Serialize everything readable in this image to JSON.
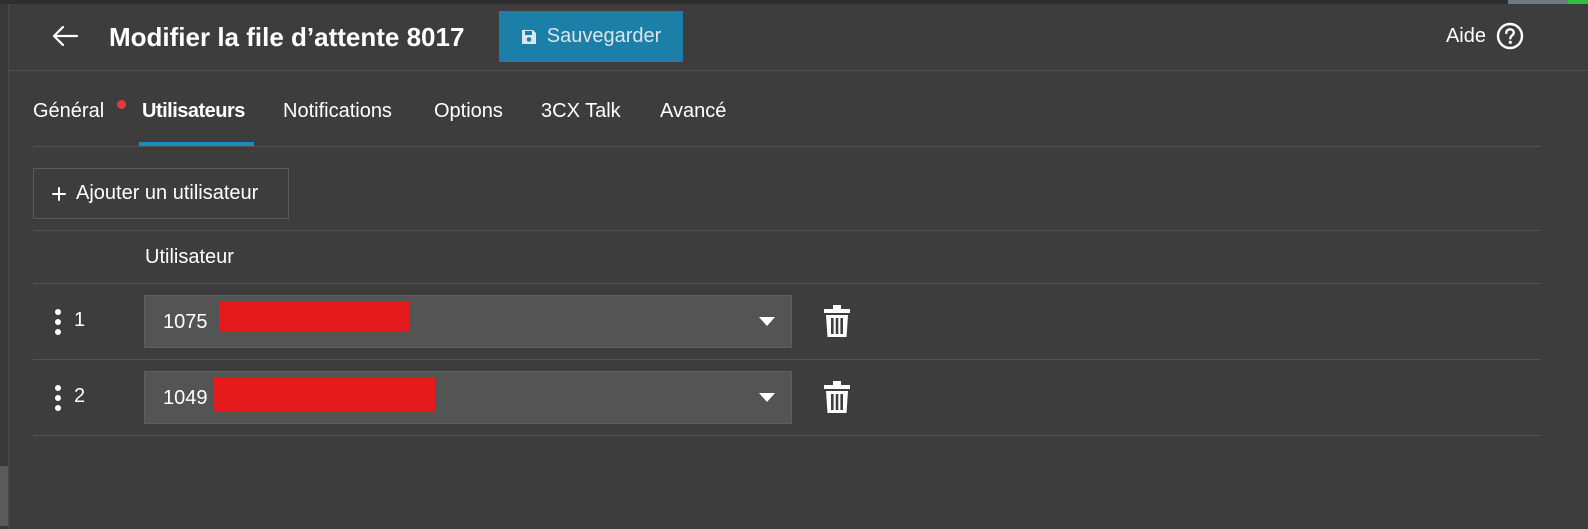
{
  "header": {
    "title": "Modifier la file d’attente 8017",
    "save_label": "Sauvegarder",
    "help_label": "Aide"
  },
  "tabs": [
    {
      "label": "Général",
      "active": false,
      "has_alert": true
    },
    {
      "label": "Utilisateurs",
      "active": true,
      "has_alert": false
    },
    {
      "label": "Notifications",
      "active": false,
      "has_alert": false
    },
    {
      "label": "Options",
      "active": false,
      "has_alert": false
    },
    {
      "label": "3CX Talk",
      "active": false,
      "has_alert": false
    },
    {
      "label": "Avancé",
      "active": false,
      "has_alert": false
    }
  ],
  "actions": {
    "add_user_label": "Ajouter un utilisateur"
  },
  "table": {
    "column_user": "Utilisateur",
    "rows": [
      {
        "index": "1",
        "extension": "1075"
      },
      {
        "index": "2",
        "extension": "1049"
      }
    ]
  },
  "colors": {
    "background": "#3d3d3d",
    "primary_button": "#1b7fa8",
    "tab_underline": "#1b8cc2",
    "alert_dot": "#e53a3a",
    "redaction": "#e51b1b",
    "select_bg": "#545454"
  },
  "icons": {
    "back": "arrow-left-icon",
    "save": "floppy-disk-icon",
    "help": "question-circle-icon",
    "add": "plus-icon",
    "drag": "vertical-dots-icon",
    "dropdown": "caret-down-icon",
    "delete": "trash-icon"
  }
}
